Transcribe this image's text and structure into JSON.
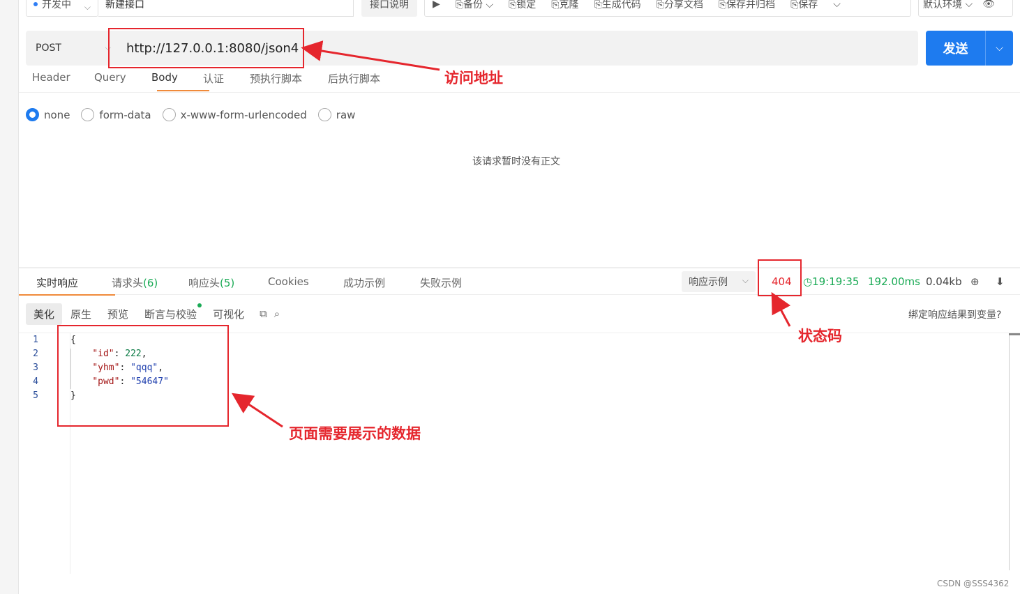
{
  "topbar": {
    "status": "开发中",
    "name": "新建接口",
    "desc_label": "接口说明",
    "actions": [
      "备份",
      "锁定",
      "克隆",
      "生成代码",
      "分享文档",
      "保存并归档",
      "保存"
    ],
    "env": "默认环境"
  },
  "request": {
    "method": "POST",
    "url": "http://127.0.0.1:8080/json4",
    "send_label": "发送",
    "tabs": [
      "Header",
      "Query",
      "Body",
      "认证",
      "预执行脚本",
      "后执行脚本"
    ],
    "active_tab": "Body",
    "body_types": [
      "none",
      "form-data",
      "x-www-form-urlencoded",
      "raw"
    ],
    "selected_body_type": "none",
    "empty_body_text": "该请求暂时没有正文"
  },
  "response": {
    "tabs": [
      {
        "label": "实时响应",
        "count": ""
      },
      {
        "label": "请求头",
        "count": "(6)"
      },
      {
        "label": "响应头",
        "count": "(5)"
      },
      {
        "label": "Cookies",
        "count": ""
      },
      {
        "label": "成功示例",
        "count": ""
      },
      {
        "label": "失败示例",
        "count": ""
      }
    ],
    "example_select": "响应示例",
    "status_code": "404",
    "time": "19:19:35",
    "duration": "192.00ms",
    "size": "0.04kb",
    "sub_tabs": [
      "美化",
      "原生",
      "预览",
      "断言与校验",
      "可视化"
    ],
    "bind_text": "绑定响应结果到变量?",
    "code_lines": [
      {
        "no": "1",
        "text": "{"
      },
      {
        "no": "2",
        "key": "\"id\"",
        "value": "222",
        "vtype": "num",
        "comma": ","
      },
      {
        "no": "3",
        "key": "\"yhm\"",
        "value": "\"qqq\"",
        "vtype": "str",
        "comma": ","
      },
      {
        "no": "4",
        "key": "\"pwd\"",
        "value": "\"54647\"",
        "vtype": "str",
        "comma": ""
      },
      {
        "no": "5",
        "text": "}"
      }
    ]
  },
  "annotations": {
    "url_note": "访问地址",
    "status_note": "状态码",
    "data_note": "页面需要展示的数据",
    "color": "#e5262d"
  },
  "watermark": "CSDN @SSS4362",
  "colors": {
    "primary": "#1e7bef",
    "accent_underline": "#f08a3a",
    "success": "#1aaa55",
    "error": "#e5262d"
  }
}
